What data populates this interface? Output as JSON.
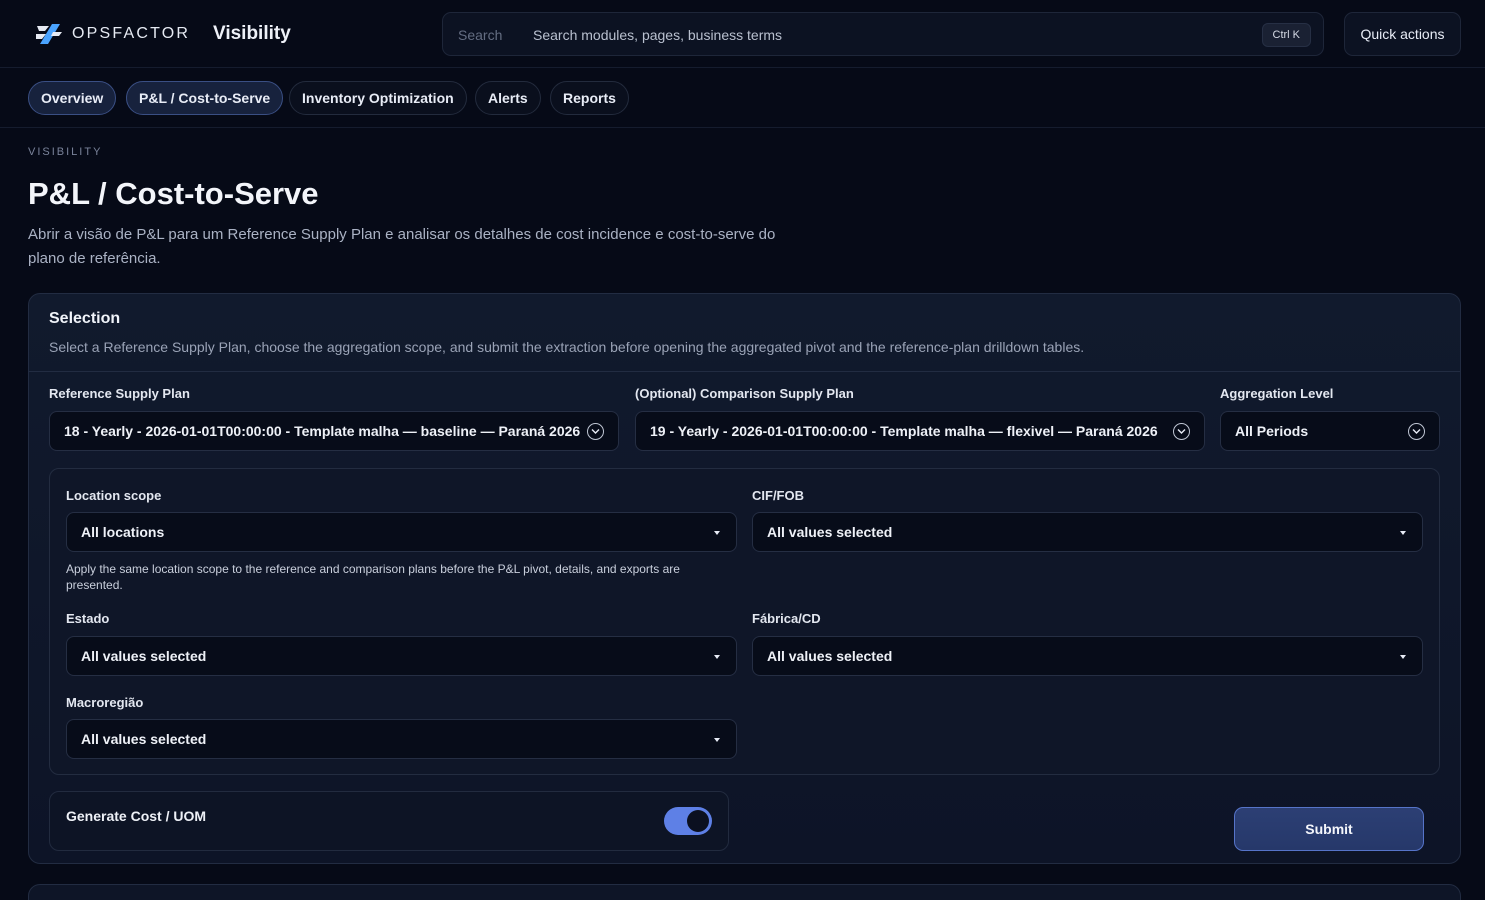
{
  "brand": {
    "name": "OPSFACTOR",
    "logo_icon": "opsfactor-logo-icon"
  },
  "app": {
    "title": "Visibility"
  },
  "search": {
    "label": "Search",
    "placeholder": "Search modules, pages, business terms",
    "shortcut": "Ctrl K"
  },
  "header": {
    "quick_actions": "Quick actions"
  },
  "tabs": [
    {
      "label": "Overview",
      "active": true
    },
    {
      "label": "P&L / Cost-to-Serve",
      "active": true
    },
    {
      "label": "Inventory Optimization",
      "active": false
    },
    {
      "label": "Alerts",
      "active": false
    },
    {
      "label": "Reports",
      "active": false
    }
  ],
  "page": {
    "eyebrow": "VISIBILITY",
    "title": "P&L / Cost-to-Serve",
    "description": "Abrir a visão de P&L para um Reference Supply Plan e analisar os detalhes de cost incidence e cost-to-serve do plano de referência."
  },
  "selection": {
    "title": "Selection",
    "subtitle": "Select a Reference Supply Plan, choose the aggregation scope, and submit the extraction before opening the aggregated pivot and the reference-plan drilldown tables.",
    "reference": {
      "label": "Reference Supply Plan",
      "value": "18 - Yearly - 2026-01-01T00:00:00 - Template malha — baseline — Paraná 2026"
    },
    "comparison": {
      "label": "(Optional) Comparison Supply Plan",
      "value": "19 - Yearly - 2026-01-01T00:00:00 - Template malha — flexivel — Paraná 2026"
    },
    "aggregation": {
      "label": "Aggregation Level",
      "value": "All Periods"
    },
    "filters": {
      "location_scope": {
        "label": "Location scope",
        "value": "All locations",
        "help": "Apply the same location scope to the reference and comparison plans before the P&L pivot, details, and exports are presented."
      },
      "cif_fob": {
        "label": "CIF/FOB",
        "value": "All values selected"
      },
      "estado": {
        "label": "Estado",
        "value": "All values selected"
      },
      "fabrica_cd": {
        "label": "Fábrica/CD",
        "value": "All values selected"
      },
      "macroregiao": {
        "label": "Macroregião",
        "value": "All values selected"
      }
    },
    "generate_cost": {
      "label": "Generate Cost / UOM",
      "enabled": true
    },
    "submit_label": "Submit"
  },
  "colors": {
    "background": "#060a17",
    "accent": "#5e80e6",
    "active_tab_bg": "#17223d",
    "submit_bg": "#2c3f74"
  }
}
